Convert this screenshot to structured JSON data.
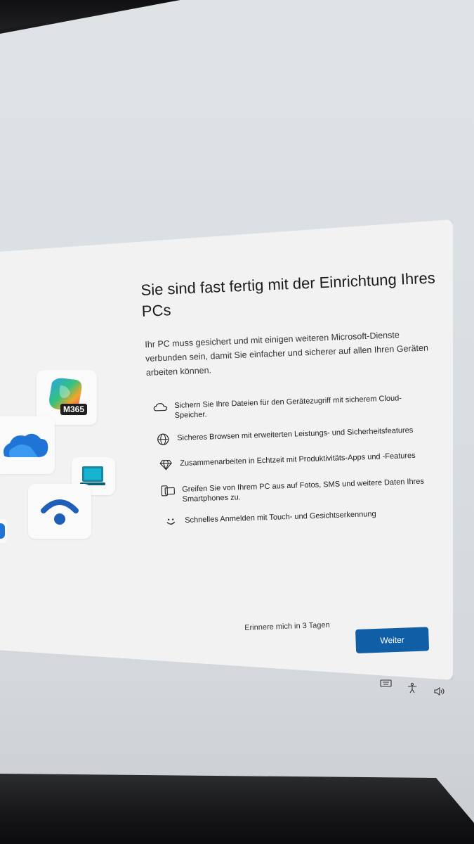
{
  "setup": {
    "title": "Sie sind fast fertig mit der Einrichtung Ihres PCs",
    "description": "Ihr PC muss gesichert und mit einigen weiteren Microsoft-Dienste verbunden sein, damit Sie einfacher und sicherer auf allen Ihren Geräten arbeiten können.",
    "features": [
      {
        "icon": "cloud-icon",
        "text": "Sichern Sie Ihre Dateien für den Gerätezugriff mit sicherem Cloud-Speicher."
      },
      {
        "icon": "globe-icon",
        "text": "Sicheres Browsen mit erweiterten Leistungs- und Sicherheitsfeatures"
      },
      {
        "icon": "diamond-icon",
        "text": "Zusammenarbeiten in Echtzeit mit Produktivitäts-Apps und -Features"
      },
      {
        "icon": "phone-pc-icon",
        "text": "Greifen Sie von Ihrem PC aus auf Fotos, SMS und weitere Daten Ihres Smartphones zu."
      },
      {
        "icon": "smile-icon",
        "text": "Schnelles Anmelden mit Touch- und Gesichtserkennung"
      }
    ],
    "remind_label": "Erinnere mich in 3 Tagen",
    "next_label": "Weiter"
  },
  "apps": {
    "m365_badge": "M365"
  },
  "taskbar": {
    "icons": [
      "keyboard-icon",
      "accessibility-icon",
      "volume-icon"
    ]
  },
  "colors": {
    "accent": "#105ea5",
    "card": "#f2f2f2"
  }
}
